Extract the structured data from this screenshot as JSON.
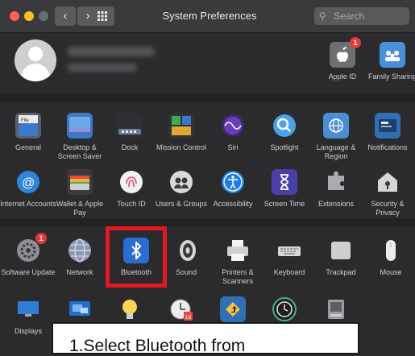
{
  "window": {
    "title": "System Preferences",
    "search_placeholder": "Search"
  },
  "traffic_lights": [
    {
      "name": "close",
      "color": "#fe5f57"
    },
    {
      "name": "minimize",
      "color": "#febc2e"
    },
    {
      "name": "zoom",
      "color": "#6d6d70"
    }
  ],
  "account_items": [
    {
      "label": "Apple ID",
      "icon": "apple-id-icon",
      "badge": "1"
    },
    {
      "label": "Family Sharing",
      "icon": "family-sharing-icon"
    }
  ],
  "rows": [
    [
      {
        "label": "General",
        "icon": "general-icon"
      },
      {
        "label": "Desktop & Screen Saver",
        "icon": "desktop-screen-saver-icon"
      },
      {
        "label": "Dock",
        "icon": "dock-icon"
      },
      {
        "label": "Mission Control",
        "icon": "mission-control-icon"
      },
      {
        "label": "Siri",
        "icon": "siri-icon"
      },
      {
        "label": "Spotlight",
        "icon": "spotlight-icon"
      },
      {
        "label": "Language & Region",
        "icon": "language-region-icon"
      },
      {
        "label": "Notifications",
        "icon": "notifications-icon"
      }
    ],
    [
      {
        "label": "Internet Accounts",
        "icon": "internet-accounts-icon"
      },
      {
        "label": "Wallet & Apple Pay",
        "icon": "wallet-icon"
      },
      {
        "label": "Touch ID",
        "icon": "touch-id-icon"
      },
      {
        "label": "Users & Groups",
        "icon": "users-groups-icon"
      },
      {
        "label": "Accessibility",
        "icon": "accessibility-icon"
      },
      {
        "label": "Screen Time",
        "icon": "screen-time-icon"
      },
      {
        "label": "Extensions",
        "icon": "extensions-icon"
      },
      {
        "label": "Security & Privacy",
        "icon": "security-privacy-icon"
      }
    ],
    [
      {
        "label": "Software Update",
        "icon": "software-update-icon",
        "badge": "1"
      },
      {
        "label": "Network",
        "icon": "network-icon"
      },
      {
        "label": "Bluetooth",
        "icon": "bluetooth-icon"
      },
      {
        "label": "Sound",
        "icon": "sound-icon"
      },
      {
        "label": "Printers & Scanners",
        "icon": "printers-scanners-icon"
      },
      {
        "label": "Keyboard",
        "icon": "keyboard-icon"
      },
      {
        "label": "Trackpad",
        "icon": "trackpad-icon"
      },
      {
        "label": "Mouse",
        "icon": "mouse-icon"
      }
    ],
    [
      {
        "label": "Displays",
        "icon": "displays-icon"
      },
      {
        "label": "",
        "icon": "sidecar-icon"
      },
      {
        "label": "",
        "icon": "energy-saver-icon"
      },
      {
        "label": "",
        "icon": "date-time-icon"
      },
      {
        "label": "",
        "icon": "sharing-icon"
      },
      {
        "label": "",
        "icon": "time-machine-icon"
      },
      {
        "label": "",
        "icon": "startup-disk-icon"
      }
    ]
  ],
  "callout": {
    "text": "1.Select Bluetooth from"
  },
  "colors": {
    "highlight": "#e4181e",
    "background": "#2b2b2d"
  }
}
